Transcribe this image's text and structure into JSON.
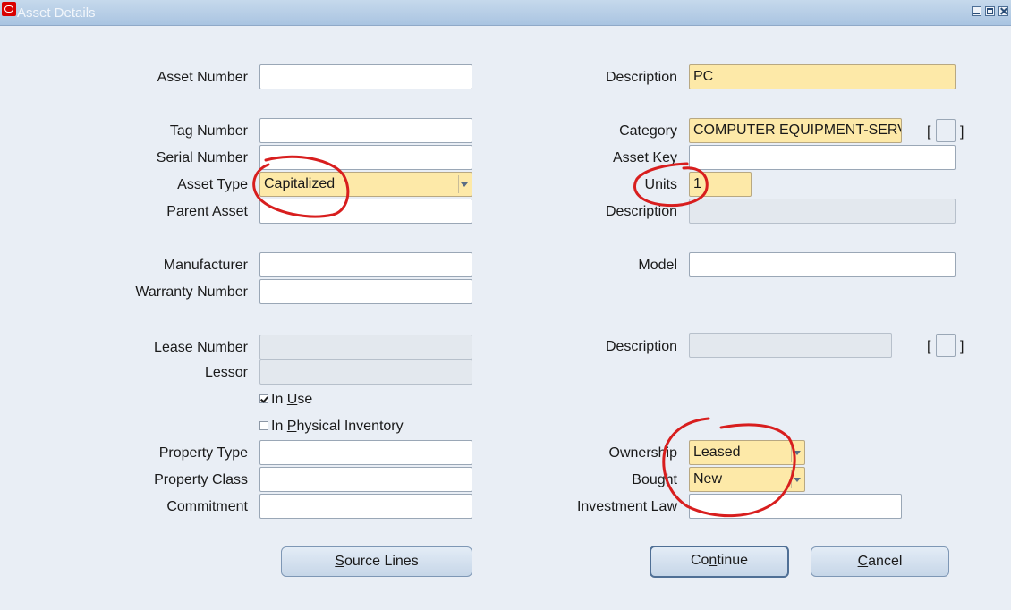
{
  "window": {
    "title": "Asset Details"
  },
  "left_fields": {
    "asset_number": {
      "label": "Asset Number",
      "value": ""
    },
    "tag_number": {
      "label": "Tag Number",
      "value": ""
    },
    "serial_number": {
      "label": "Serial Number",
      "value": ""
    },
    "asset_type": {
      "label": "Asset Type",
      "value": "Capitalized"
    },
    "parent_asset": {
      "label": "Parent Asset",
      "value": ""
    },
    "manufacturer": {
      "label": "Manufacturer",
      "value": ""
    },
    "warranty_number": {
      "label": "Warranty Number",
      "value": ""
    },
    "lease_number": {
      "label": "Lease Number",
      "value": ""
    },
    "lessor": {
      "label": "Lessor",
      "value": ""
    },
    "property_type": {
      "label": "Property Type",
      "value": ""
    },
    "property_class": {
      "label": "Property Class",
      "value": ""
    },
    "commitment": {
      "label": "Commitment",
      "value": ""
    }
  },
  "right_fields": {
    "description": {
      "label": "Description",
      "value": "PC"
    },
    "category": {
      "label": "Category",
      "value": "COMPUTER EQUIPMENT-SERV"
    },
    "asset_key": {
      "label": "Asset Key",
      "value": ""
    },
    "units": {
      "label": "Units",
      "value": "1"
    },
    "category_description": {
      "label": "Description",
      "value": ""
    },
    "model": {
      "label": "Model",
      "value": ""
    },
    "lease_description": {
      "label": "Description",
      "value": ""
    },
    "ownership": {
      "label": "Ownership",
      "value": "Leased"
    },
    "bought": {
      "label": "Bought",
      "value": "New"
    },
    "investment_law": {
      "label": "Investment Law",
      "value": ""
    }
  },
  "checkboxes": {
    "in_use": {
      "label_prefix": "In ",
      "label_mnemonic": "U",
      "label_rest": "se",
      "checked": true
    },
    "in_physical_inventory": {
      "label_prefix": "In ",
      "label_mnemonic": "P",
      "label_rest": "hysical Inventory",
      "checked": false
    }
  },
  "buttons": {
    "source_lines": {
      "mnemonic": "S",
      "rest": "ource Lines"
    },
    "continue": {
      "prefix": "Co",
      "mnemonic": "n",
      "rest": "tinue"
    },
    "cancel": {
      "mnemonic": "C",
      "rest": "ancel"
    }
  },
  "brackets": {
    "open": "[",
    "close": "]"
  },
  "colors": {
    "required_field": "#fde9a8",
    "readonly_field": "#e3e8ee",
    "annotation_red": "#d81e1e",
    "titlebar": "#a9c4e1"
  }
}
